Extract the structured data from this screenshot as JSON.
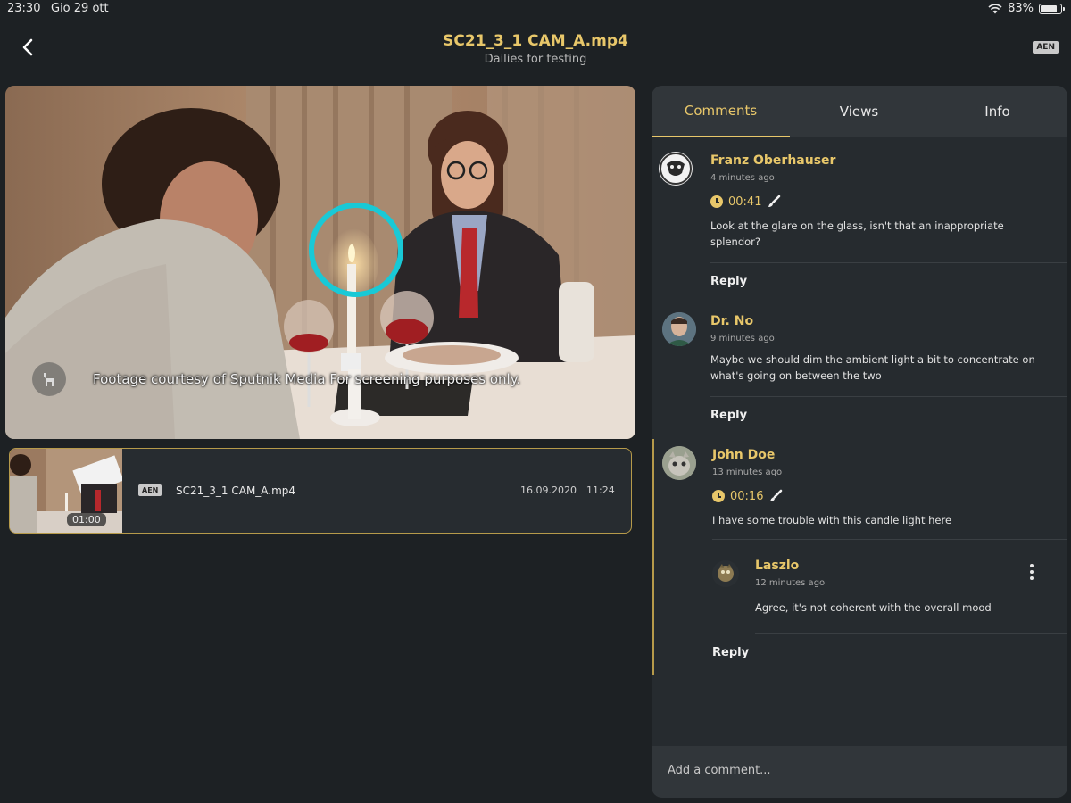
{
  "status_bar": {
    "time": "23:30",
    "date": "Gio 29 ott",
    "battery": "83%",
    "battery_level": 0.83
  },
  "header": {
    "back_icon": "chevron-left-icon",
    "title": "SC21_3_1 CAM_A.mp4",
    "subtitle": "Dailies for testing",
    "language_badge": "AEN"
  },
  "video": {
    "caption": "Footage courtesy of Sputnik Media For screening purposes only.",
    "annotation_color": "#19c9d6"
  },
  "clip": {
    "duration": "01:00",
    "language_badge": "AEN",
    "filename": "SC21_3_1 CAM_A.mp4",
    "date": "16.09.2020",
    "time": "11:24"
  },
  "tabs": [
    {
      "label": "Comments",
      "active": true
    },
    {
      "label": "Views",
      "active": false
    },
    {
      "label": "Info",
      "active": false
    }
  ],
  "comments": [
    {
      "author": "Franz Oberhauser",
      "time": "4 minutes ago",
      "timestamp": "00:41",
      "text": "Look at the glare on the glass, isn't that an inappropriate splendor?",
      "reply_label": "Reply"
    },
    {
      "author": "Dr. No",
      "time": "9 minutes ago",
      "text": "Maybe we should dim the ambient light a bit to concentrate on what's going on between the two",
      "reply_label": "Reply"
    },
    {
      "author": "John Doe",
      "time": "13 minutes ago",
      "timestamp": "00:16",
      "text": "I have some trouble with this candle light here",
      "reply_label": "Reply",
      "replies": [
        {
          "author": "Laszlo",
          "time": "12 minutes ago",
          "text": "Agree, it's not coherent with the overall mood"
        }
      ]
    }
  ],
  "add_comment": {
    "placeholder": "Add a comment..."
  },
  "colors": {
    "accent": "#e8c76a",
    "background": "#1d2124",
    "panel": "#262b2f"
  }
}
